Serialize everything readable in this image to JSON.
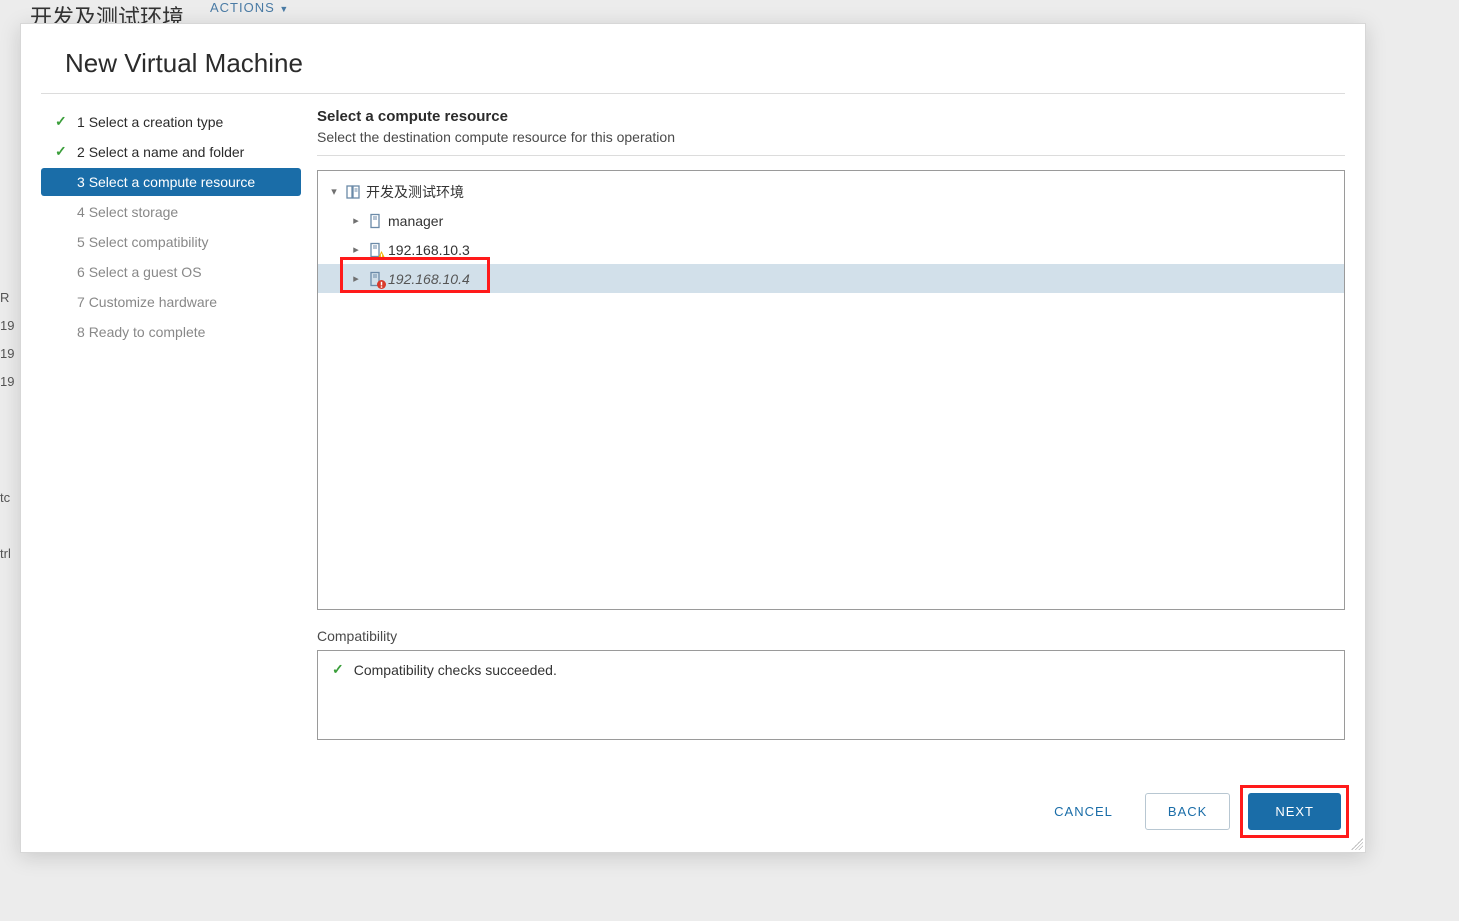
{
  "background": {
    "title_frag": "开发及测试环境",
    "actions": "ACTIONS",
    "side": [
      "R",
      "19",
      "19",
      "19",
      "",
      "tc",
      "",
      "trl"
    ]
  },
  "modal": {
    "title": "New Virtual Machine",
    "steps": [
      {
        "num": "1",
        "label": "Select a creation type",
        "state": "done"
      },
      {
        "num": "2",
        "label": "Select a name and folder",
        "state": "done"
      },
      {
        "num": "3",
        "label": "Select a compute resource",
        "state": "active"
      },
      {
        "num": "4",
        "label": "Select storage",
        "state": "pending"
      },
      {
        "num": "5",
        "label": "Select compatibility",
        "state": "pending"
      },
      {
        "num": "6",
        "label": "Select a guest OS",
        "state": "pending"
      },
      {
        "num": "7",
        "label": "Customize hardware",
        "state": "pending"
      },
      {
        "num": "8",
        "label": "Ready to complete",
        "state": "pending"
      }
    ],
    "content": {
      "heading": "Select a compute resource",
      "sub": "Select the destination compute resource for this operation",
      "tree": {
        "datacenter": "开发及测试环境",
        "hosts": [
          {
            "name": "manager",
            "badge": "none",
            "selected": false,
            "italic": false
          },
          {
            "name": "192.168.10.3",
            "badge": "warn",
            "selected": false,
            "italic": false
          },
          {
            "name": "192.168.10.4",
            "badge": "error",
            "selected": true,
            "italic": true
          }
        ]
      },
      "compatibility": {
        "label": "Compatibility",
        "message": "Compatibility checks succeeded."
      }
    },
    "footer": {
      "cancel": "CANCEL",
      "back": "BACK",
      "next": "NEXT"
    }
  }
}
